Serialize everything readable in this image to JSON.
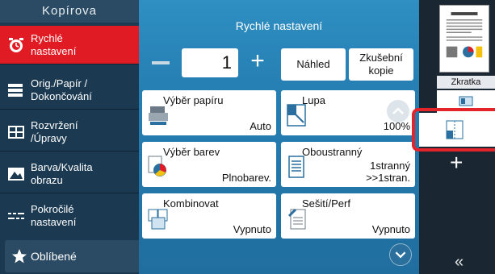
{
  "sidebar": {
    "header": "Kopírova",
    "items": [
      {
        "label": "Rychlé\nnastavení",
        "icon": "quick-settings-icon"
      },
      {
        "label": "Orig./Papír /\nDokončování",
        "icon": "paper-stack-icon"
      },
      {
        "label": "Rozvržení\n/Úpravy",
        "icon": "layout-edit-icon"
      },
      {
        "label": "Barva/Kvalita\nobrazu",
        "icon": "image-quality-icon"
      },
      {
        "label": "Pokročilé\nnastavení",
        "icon": "advanced-settings-icon"
      }
    ],
    "favorites": {
      "label": "Oblíbené",
      "icon": "star-icon"
    }
  },
  "main": {
    "title": "Rychlé nastavení",
    "quantity": "1",
    "preview_label": "Náhled",
    "test_copy_label": "Zkušební\nkopie",
    "tiles": [
      {
        "label": "Výběr papíru",
        "value": "Auto",
        "icon": "paper-tray-icon"
      },
      {
        "label": "Lupa",
        "value": "100%",
        "icon": "zoom-icon"
      },
      {
        "label": "Výběr barev",
        "value": "Plnobarev.",
        "icon": "color-select-icon"
      },
      {
        "label": "Oboustranný",
        "value": "1stranný\n>>1stran.",
        "icon": "duplex-icon"
      },
      {
        "label": "Kombinovat",
        "value": "Vypnuto",
        "icon": "combine-icon"
      },
      {
        "label": "Sešití/Perf",
        "value": "Vypnuto",
        "icon": "staple-icon"
      }
    ]
  },
  "right": {
    "shortcut_label": "Zkratka",
    "add_label": "+",
    "collapse_label": "«"
  },
  "colors": {
    "accent_red": "#e11b24",
    "panel_blue": "#2680b4",
    "sidebar_dark": "#1b3a52"
  }
}
